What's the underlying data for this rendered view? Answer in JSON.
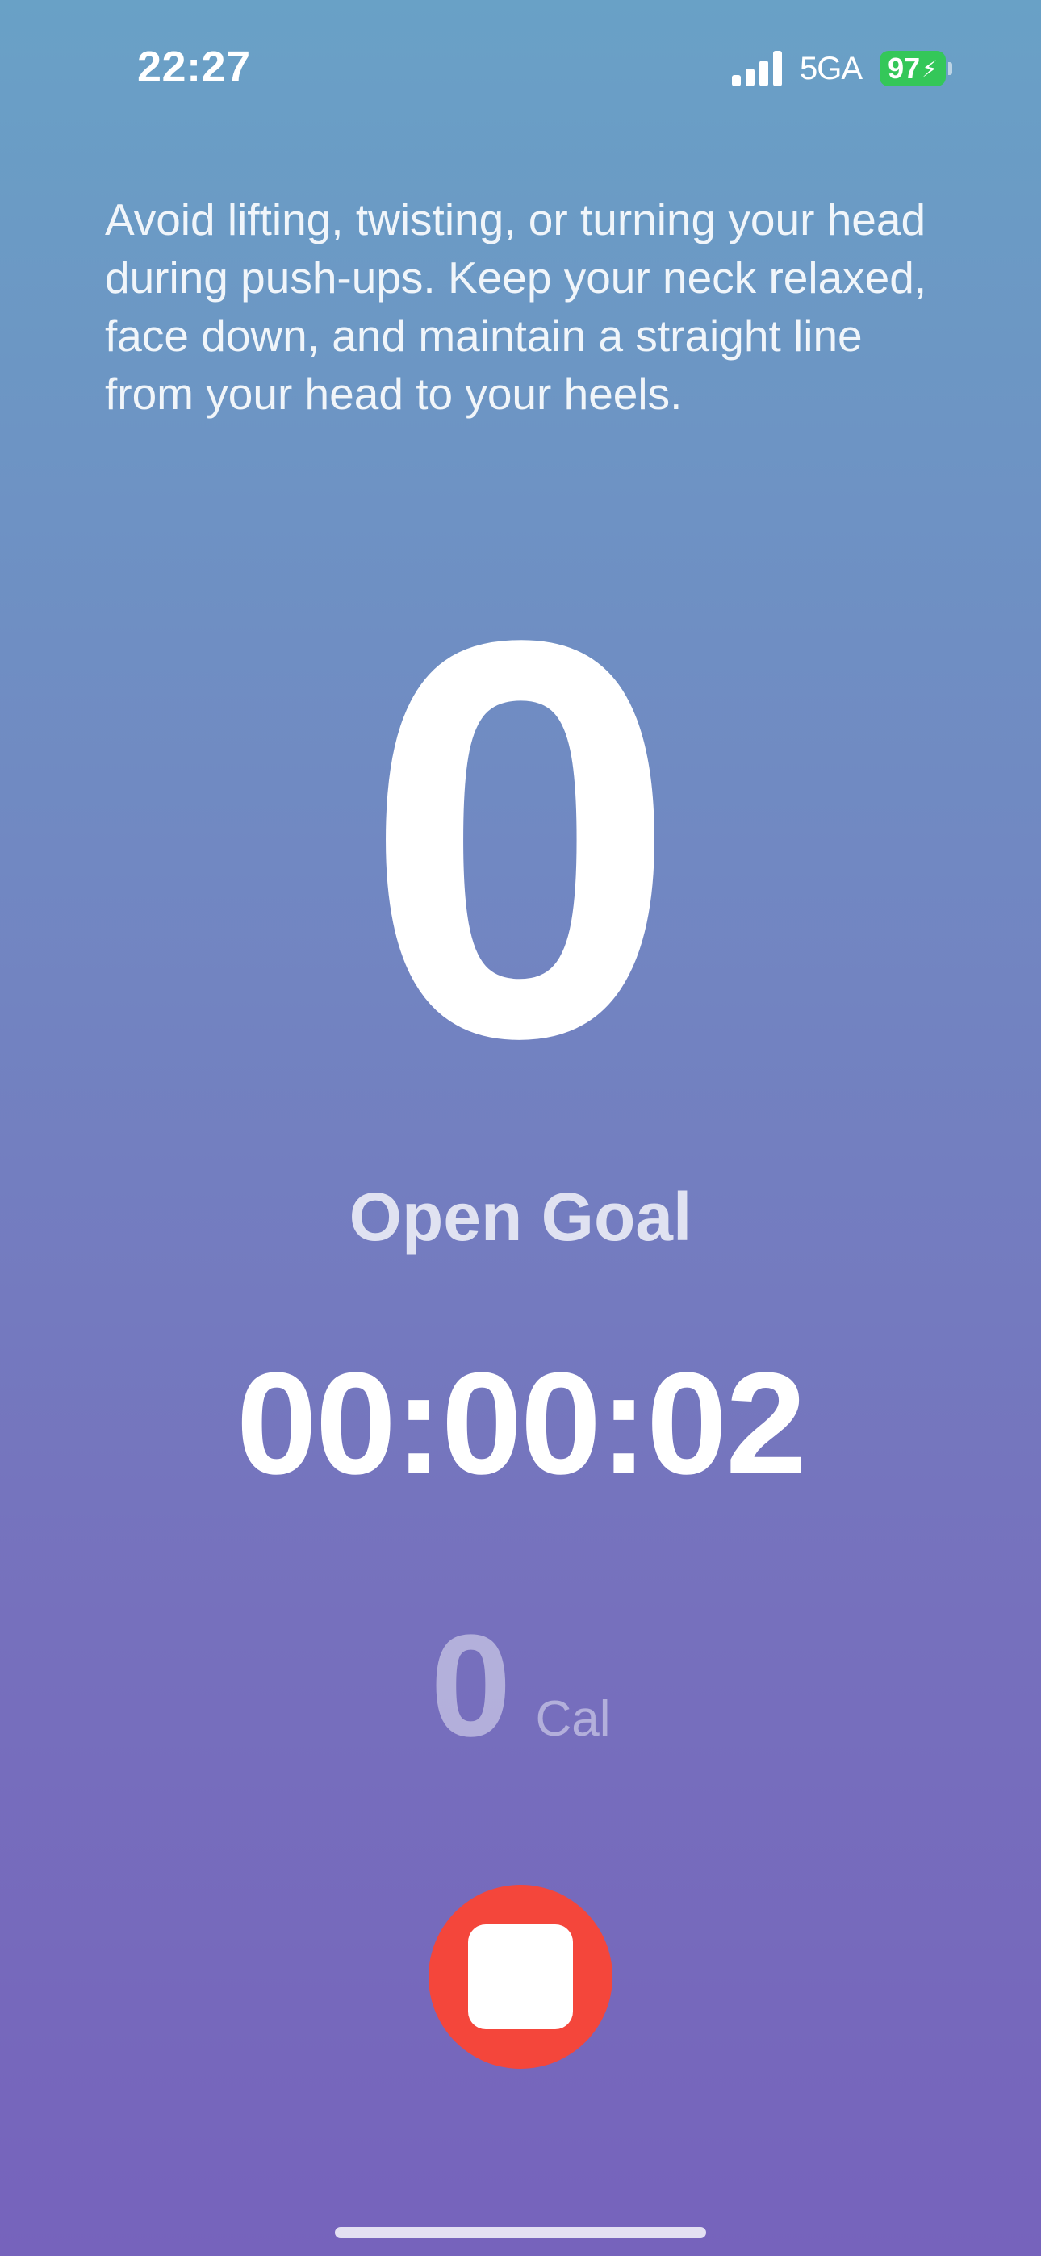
{
  "status_bar": {
    "time": "22:27",
    "network": "5GA",
    "battery_percent": "97",
    "battery_charging": true,
    "signal_bars": 4,
    "battery_color": "#34c759"
  },
  "workout": {
    "tip": "Avoid lifting, twisting, or turning your head during push-ups. Keep your neck relaxed, face down, and maintain a straight line from your head to your heels.",
    "rep_count": "0",
    "goal_label": "Open Goal",
    "elapsed_time": "00:00:02",
    "calories_value": "0",
    "calories_unit": "Cal"
  },
  "controls": {
    "stop_icon": "stop-icon",
    "stop_color": "#f4463b"
  },
  "colors": {
    "background_top": "#69a1c6",
    "background_bottom": "#7663bc"
  }
}
